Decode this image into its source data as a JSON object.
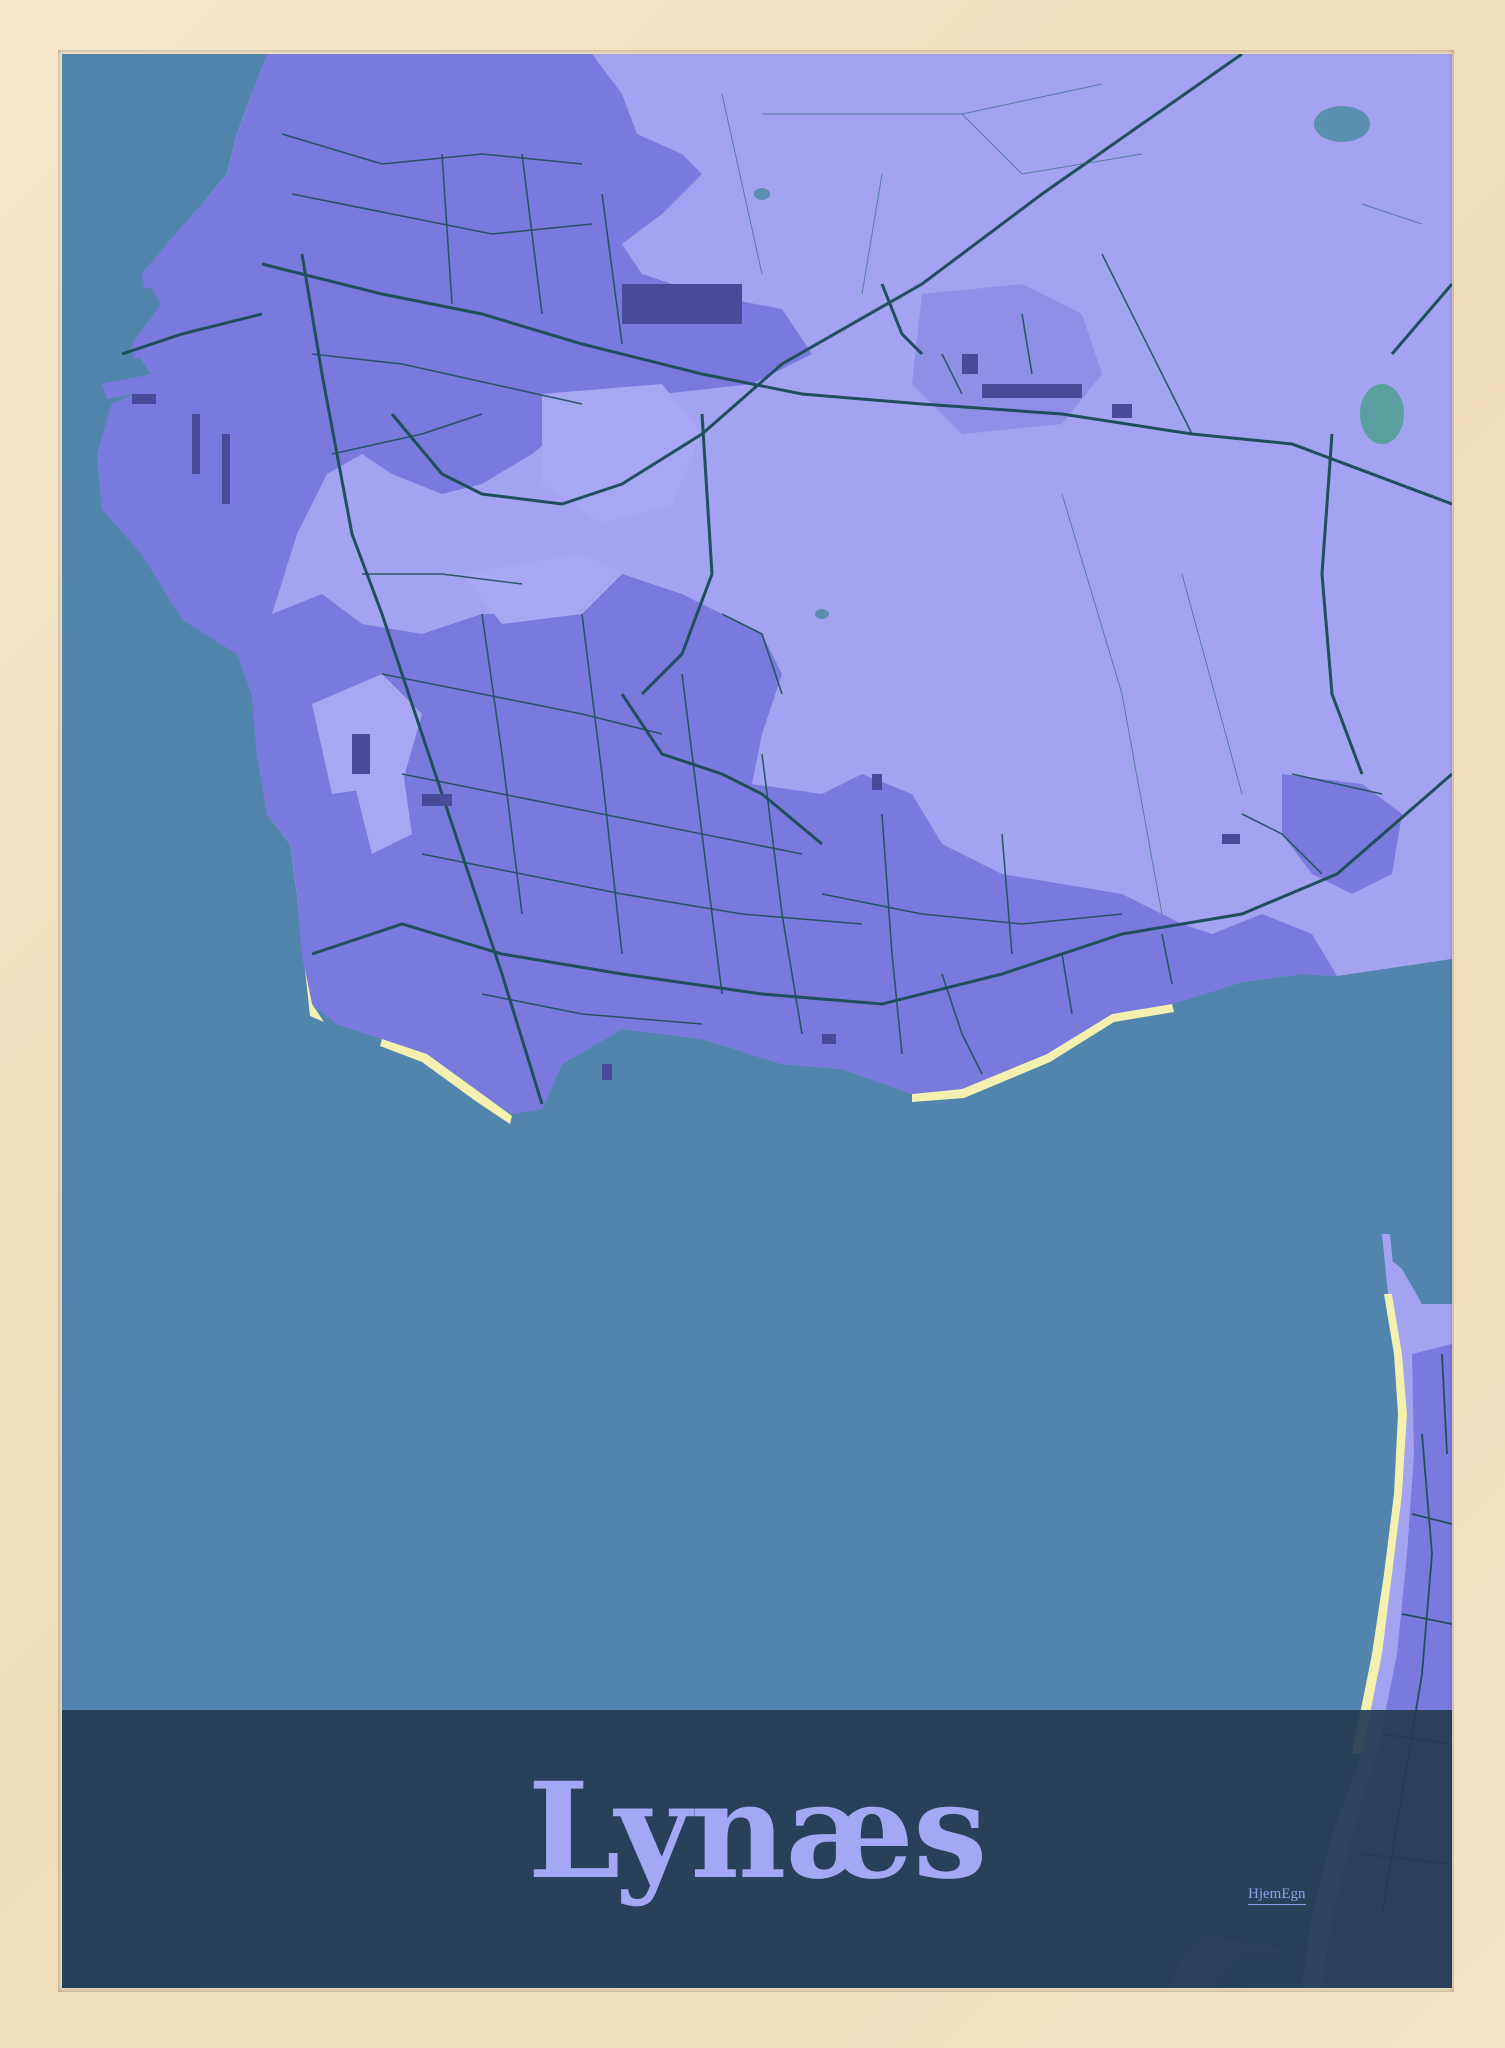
{
  "poster": {
    "title": "Lynæs",
    "brand": "HjemEgn"
  },
  "colors": {
    "frame": "#f3e3c4",
    "water": "#5285ae",
    "land": "#a3a3f1",
    "urban": "#7a7ade",
    "roads": "#1f4f5c",
    "buildings": "#4a4a9a",
    "beach": "#f4f0b0",
    "title_band": "#253c54",
    "title_text": "#a3a7f4"
  }
}
